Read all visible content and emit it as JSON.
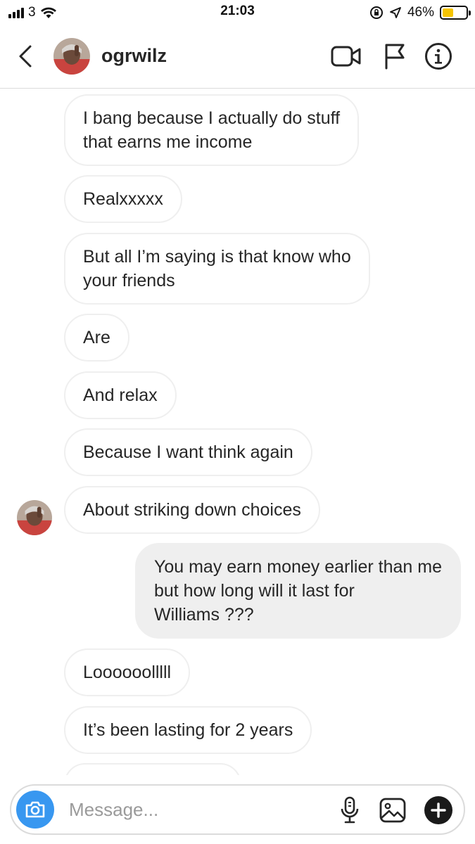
{
  "status_bar": {
    "carrier": "3",
    "time": "21:03",
    "battery_percent": "46%",
    "battery_level": 0.46,
    "battery_color": "#f5c400"
  },
  "header": {
    "username": "ogrwilz",
    "icons": [
      "back-chevron-icon",
      "video-call-icon",
      "flag-icon",
      "info-icon"
    ]
  },
  "messages": [
    {
      "sender": "them",
      "text": "I bang because I actually do stuff\nthat earns me income"
    },
    {
      "sender": "them",
      "text": "Realxxxxx"
    },
    {
      "sender": "them",
      "text": "But all I’m saying is that know who\nyour friends"
    },
    {
      "sender": "them",
      "text": "Are"
    },
    {
      "sender": "them",
      "text": "And relax"
    },
    {
      "sender": "them",
      "text": "Because I want think again"
    },
    {
      "sender": "them",
      "text": "About striking down choices",
      "show_avatar": true
    },
    {
      "sender": "me",
      "text": "You may earn money earlier than me\nbut how long will it last for\nWilliams ???"
    },
    {
      "sender": "them",
      "text": "Loooooolllll"
    },
    {
      "sender": "them",
      "text": "It’s been lasting for 2 years"
    }
  ],
  "composer": {
    "placeholder": "Message...",
    "icons": [
      "camera-icon",
      "microphone-icon",
      "gallery-icon",
      "plus-icon"
    ],
    "accent": "#3897f0"
  }
}
